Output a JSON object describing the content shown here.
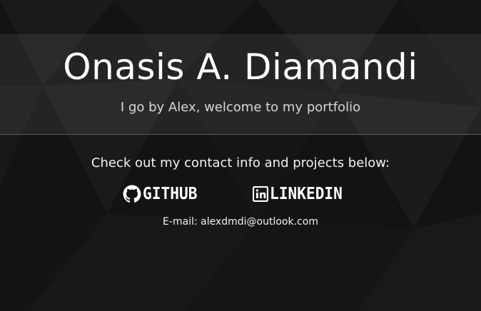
{
  "hero": {
    "name": "Onasis A. Diamandi",
    "tagline": "I go by Alex, welcome to my portfolio"
  },
  "contact": {
    "intro": "Check out my contact info and projects below:",
    "github": {
      "label": "GITHUB",
      "icon": "github-icon"
    },
    "linkedin": {
      "label": "LINKEDIN",
      "icon": "linkedin-icon"
    },
    "email_label": "E-mail:",
    "email_value": "alexdmdi@outlook.com"
  },
  "colors": {
    "background": "#131313",
    "text": "#ffffff",
    "divider": "#5a5a5a"
  }
}
